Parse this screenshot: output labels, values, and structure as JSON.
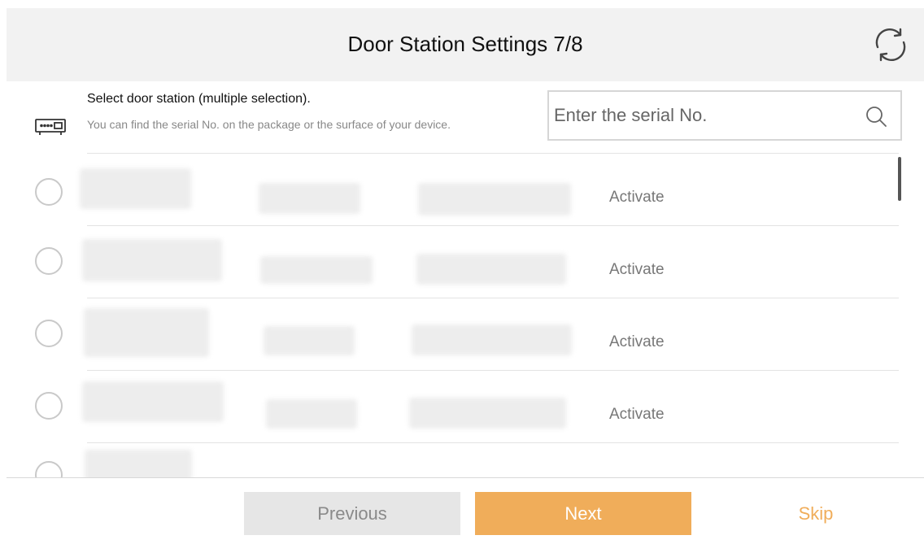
{
  "header": {
    "title": "Door Station Settings 7/8",
    "refresh_icon": "refresh-icon"
  },
  "instructions": {
    "title": "Select door station (multiple selection).",
    "description": "You can find the serial No. on the package or the surface of your device.",
    "icon": "door-station-device-icon"
  },
  "search": {
    "placeholder": "Enter the serial No.",
    "value": "",
    "icon": "search-icon"
  },
  "devices": [
    {
      "action_label": "Activate",
      "selected": false
    },
    {
      "action_label": "Activate",
      "selected": false
    },
    {
      "action_label": "Activate",
      "selected": false
    },
    {
      "action_label": "Activate",
      "selected": false
    },
    {
      "action_label": "",
      "selected": false
    }
  ],
  "footer": {
    "previous_label": "Previous",
    "next_label": "Next",
    "skip_label": "Skip"
  },
  "colors": {
    "accent": "#f0ad5a",
    "header_bg": "#f2f2f2",
    "disabled_button_bg": "#e6e6e6",
    "muted_text": "#777777"
  }
}
